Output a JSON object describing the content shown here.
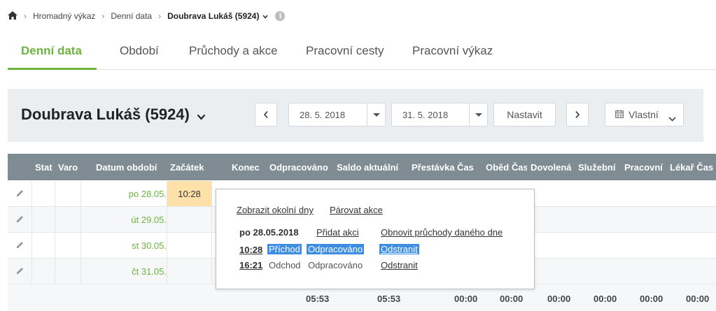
{
  "breadcrumb": {
    "items": [
      "Hromadný výkaz",
      "Denní data"
    ],
    "current": "Doubrava Lukáš (5924)",
    "info": "i"
  },
  "tabs": [
    "Denní data",
    "Období",
    "Průchody a akce",
    "Pracovní cesty",
    "Pracovní výkaz"
  ],
  "header": {
    "person": "Doubrava Lukáš (5924)",
    "date_from": "28. 5. 2018",
    "date_to": "31. 5. 2018",
    "set_label": "Nastavit",
    "range_label": "Vlastní"
  },
  "table": {
    "columns": [
      "Stat",
      "Varo",
      "Datum období",
      "Začátek",
      "Konec",
      "Odpracováno",
      "Saldo aktuální",
      "Přestávka Čas",
      "Oběd Čas",
      "Dovolená",
      "Služební",
      "Pracovní",
      "Lékař Čas"
    ],
    "rows": [
      {
        "date": "po 28.05.",
        "start": "10:28"
      },
      {
        "date": "út 29.05.",
        "start": ""
      },
      {
        "date": "st 30.05.",
        "start": ""
      },
      {
        "date": "čt 31.05.",
        "start": ""
      }
    ],
    "totals": [
      "05:53",
      "05:53",
      "00:00",
      "00:00",
      "00:00",
      "00:00",
      "00:00",
      "00:00"
    ]
  },
  "popup": {
    "show_days": "Zobrazit okolní dny",
    "pair": "Párovat akce",
    "day": "po 28.05.2018",
    "add": "Přidat akci",
    "refresh": "Obnovit průchody daného dne",
    "events": [
      {
        "time": "10:28",
        "type": "Příchod",
        "status": "Odpracováno",
        "action": "Odstranit",
        "selected": true
      },
      {
        "time": "16:21",
        "type": "Odchod",
        "status": "Odpracováno",
        "action": "Odstranit",
        "selected": false
      }
    ]
  },
  "colors": {
    "accent": "#6cb33f",
    "header_bg": "#7f8c94",
    "highlight": "#fde1a8",
    "selection": "#3d8ee3"
  }
}
